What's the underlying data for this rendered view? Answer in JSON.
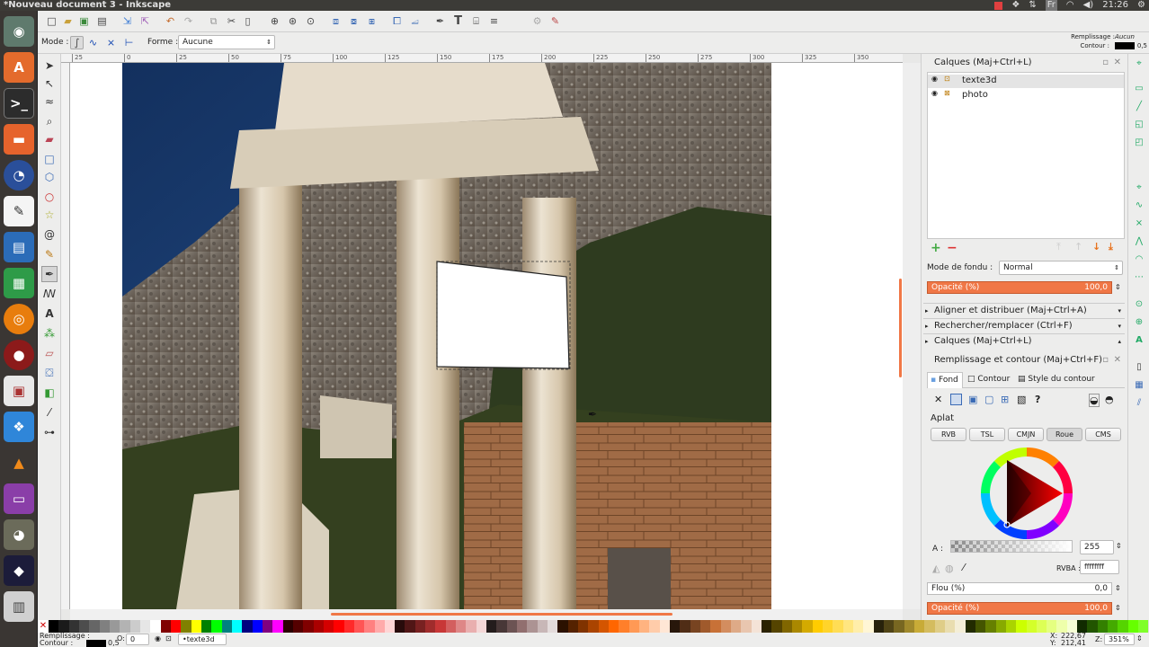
{
  "window": {
    "title": "*Nouveau document 3 - Inkscape"
  },
  "system_tray": {
    "keyboard": "Fr",
    "clock": "21:26"
  },
  "control_bar": {
    "mode_label": "Mode :",
    "shape_label": "Forme :",
    "shape_value": "Aucune",
    "fill_label": "Remplissage :",
    "fill_value": "Aucun",
    "stroke_label": "Contour :",
    "stroke_width": "0,5"
  },
  "ruler_h": [
    "25",
    "0",
    "25",
    "50",
    "75",
    "100",
    "125",
    "150",
    "175",
    "200",
    "225",
    "250",
    "275",
    "300",
    "325",
    "350"
  ],
  "layers_panel": {
    "title": "Calques (Maj+Ctrl+L)",
    "layers": [
      {
        "name": "texte3d"
      },
      {
        "name": "photo"
      }
    ],
    "blend_label": "Mode de fondu :",
    "blend_value": "Normal",
    "opacity_label": "Opacité (%)",
    "opacity_value": "100,0"
  },
  "collapsed_panels": [
    {
      "title": "Aligner et distribuer (Maj+Ctrl+A)"
    },
    {
      "title": "Rechercher/remplacer (Ctrl+F)"
    },
    {
      "title": "Calques (Maj+Ctrl+L)"
    }
  ],
  "fill_stroke": {
    "title": "Remplissage et contour (Maj+Ctrl+F)",
    "tabs": [
      "Fond",
      "Contour",
      "Style du contour"
    ],
    "paint_label": "Aplat",
    "modes": [
      "RVB",
      "TSL",
      "CMJN",
      "Roue",
      "CMS"
    ],
    "alpha_label": "A :",
    "alpha_value": "255",
    "rgba_label": "RVBA :",
    "rgba_value": "ffffffff",
    "blur_label": "Flou (%)",
    "blur_value": "0,0",
    "opacity_label": "Opacité (%)",
    "opacity_value": "100,0",
    "fill_question": "?"
  },
  "status_bar": {
    "fill_label": "Remplissage :",
    "stroke_label": "Contour :",
    "stroke_width": "0,5",
    "opacity_value": "0",
    "layer_value": "•texte3d",
    "x_label": "X:",
    "x_value": "222,67",
    "y_label": "Y:",
    "y_value": "212,41",
    "z_label": "Z:",
    "zoom_value": "351%"
  },
  "colors": {
    "accent": "#f07746",
    "topbar": "#3c3b37",
    "launcher": "#3a3633"
  }
}
